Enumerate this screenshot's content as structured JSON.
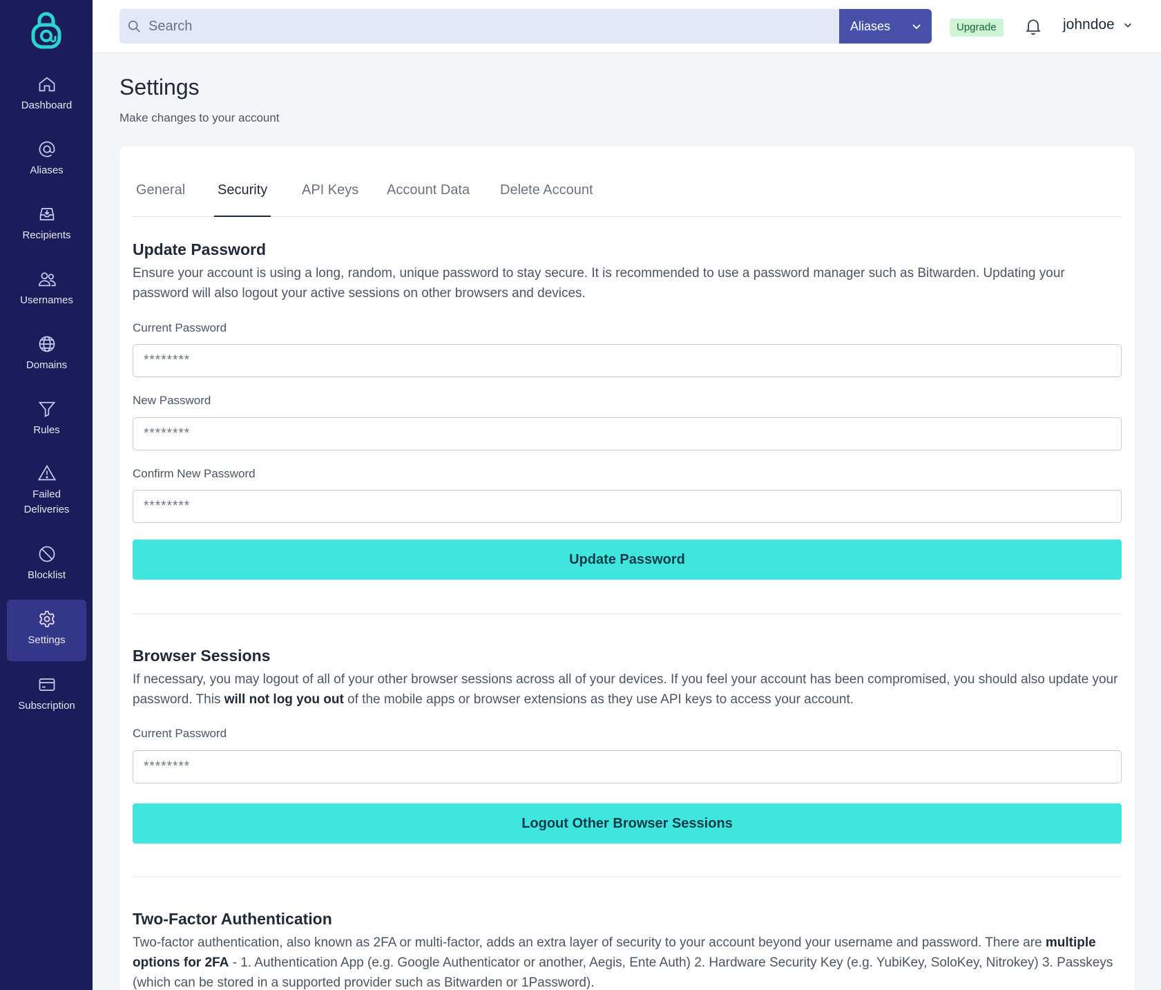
{
  "sidebar": {
    "items": [
      {
        "label": "Dashboard"
      },
      {
        "label": "Aliases"
      },
      {
        "label": "Recipients"
      },
      {
        "label": "Usernames"
      },
      {
        "label": "Domains"
      },
      {
        "label": "Rules"
      },
      {
        "label": "Failed",
        "label2": "Deliveries"
      },
      {
        "label": "Blocklist"
      },
      {
        "label": "Settings"
      },
      {
        "label": "Subscription"
      }
    ],
    "active": "Settings"
  },
  "topbar": {
    "search_placeholder": "Search",
    "search_scope": "Aliases",
    "upgrade_label": "Upgrade",
    "username": "johndoe"
  },
  "page": {
    "title": "Settings",
    "subtitle": "Make changes to your account"
  },
  "tabs": [
    {
      "label": "General"
    },
    {
      "label": "Security"
    },
    {
      "label": "API Keys"
    },
    {
      "label": "Account Data"
    },
    {
      "label": "Delete Account"
    }
  ],
  "active_tab": "Security",
  "update_password": {
    "title": "Update Password",
    "description": "Ensure your account is using a long, random, unique password to stay secure. It is recommended to use a password manager such as Bitwarden. Updating your password will also logout your active sessions on other browsers and devices.",
    "current_label": "Current Password",
    "current_placeholder": "********",
    "new_label": "New Password",
    "new_placeholder": "********",
    "confirm_label": "Confirm New Password",
    "confirm_placeholder": "********",
    "button": "Update Password"
  },
  "browser_sessions": {
    "title": "Browser Sessions",
    "desc_part1": "If necessary, you may logout of all of your other browser sessions across all of your devices. If you feel your account has been compromised, you should also update your password. This ",
    "desc_bold": "will not log you out",
    "desc_part2": " of the mobile apps or browser extensions as they use API keys to access your account.",
    "current_label": "Current Password",
    "current_placeholder": "********",
    "button": "Logout Other Browser Sessions"
  },
  "two_factor": {
    "title": "Two-Factor Authentication",
    "desc_part1": "Two-factor authentication, also known as 2FA or multi-factor, adds an extra layer of security to your account beyond your username and password. There are ",
    "desc_bold": "multiple options for 2FA",
    "desc_part2": " - 1. Authentication App (e.g. Google Authenticator or another, Aegis, Ente Auth) 2. Hardware Security Key (e.g. YubiKey, SoloKey, Nitrokey) 3. Passkeys (which can be stored in a supported provider such as Bitwarden or 1Password)."
  },
  "colors": {
    "sidebar_bg": "#1b1c5a",
    "sidebar_active": "#34368a",
    "accent_button": "#3ee6dd",
    "search_select": "#4652a8",
    "logo": "#2dd4cf"
  }
}
